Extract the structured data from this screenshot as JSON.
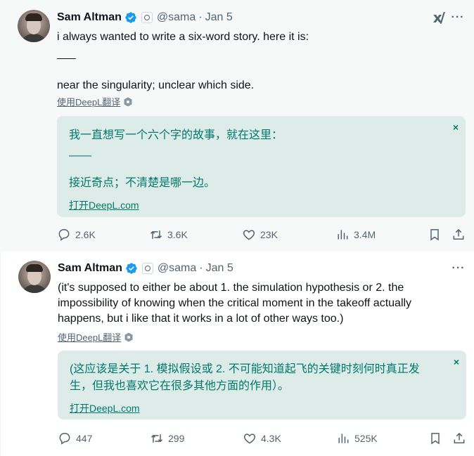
{
  "tweets": [
    {
      "author": "Sam Altman",
      "handle": "@sama",
      "separator": "·",
      "date": "Jan 5",
      "lines": [
        "i always wanted to write a six-word story. here it is:",
        "___",
        "near the singularity; unclear which side."
      ],
      "translate_label": "使用DeepL翻译",
      "translation": {
        "lines": [
          "我一直想写一个六个字的故事，就在这里：",
          "——",
          "接近奇点；不清楚是哪一边。"
        ],
        "open_label": "打开DeepL.com",
        "close": "×"
      },
      "stats": {
        "replies": "2.6K",
        "reposts": "3.6K",
        "likes": "23K",
        "views": "3.4M"
      }
    },
    {
      "author": "Sam Altman",
      "handle": "@sama",
      "separator": "·",
      "date": "Jan 5",
      "lines": [
        "(it's supposed to either be about 1. the simulation hypothesis or 2. the",
        "impossibility of knowing when the critical moment in the takeoff actually",
        "happens, but i like that it works in a lot of other ways too.)"
      ],
      "translate_label": "使用DeepL翻译",
      "translation": {
        "lines": [
          "(这应该是关于 1. 模拟假设或 2. 不可能知道起飞的关键时刻何时真正发",
          "生，但我也喜欢它在很多其他方面的作用）。"
        ],
        "open_label": "打开DeepL.com",
        "close": "×"
      },
      "stats": {
        "replies": "447",
        "reposts": "299",
        "likes": "4.3K",
        "views": "525K"
      }
    }
  ],
  "icons": {
    "verified": "verified-badge-icon",
    "affiliation": "openai-affiliation-icon",
    "grok": "grok-icon",
    "more": "more-icon",
    "reply": "reply-icon",
    "repost": "repost-icon",
    "like": "heart-icon",
    "views": "views-icon",
    "bookmark": "bookmark-icon",
    "share": "share-icon"
  },
  "colors": {
    "verified": "#1d9bf0",
    "translation_text": "#00796b",
    "translation_bg": "#deece9",
    "muted": "#536471"
  },
  "top_icons": {
    "grok": "x/",
    "more": "···"
  }
}
